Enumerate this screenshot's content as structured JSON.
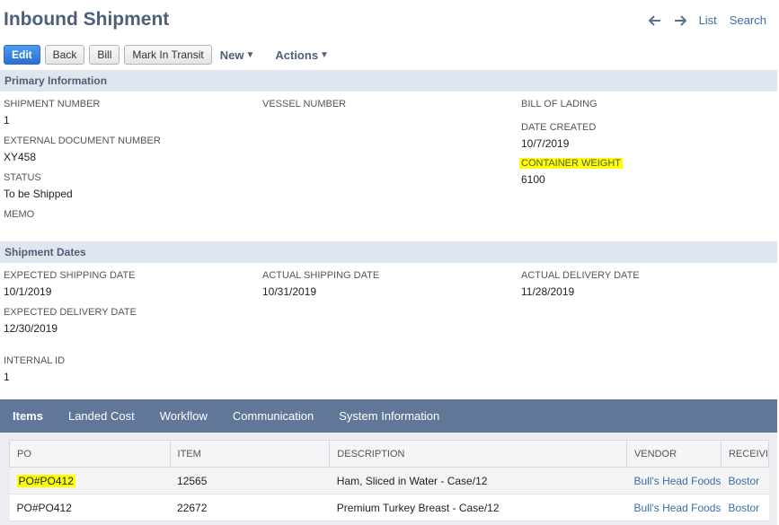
{
  "page": {
    "title": "Inbound Shipment"
  },
  "topnav": {
    "list": "List",
    "search": "Search"
  },
  "toolbar": {
    "edit": "Edit",
    "back": "Back",
    "bill": "Bill",
    "mark_in_transit": "Mark In Transit",
    "new": "New",
    "actions": "Actions"
  },
  "primary": {
    "header": "Primary Information",
    "shipment_number_label": "SHIPMENT NUMBER",
    "shipment_number": "1",
    "external_doc_label": "EXTERNAL DOCUMENT NUMBER",
    "external_doc": "XY458",
    "status_label": "STATUS",
    "status": "To be Shipped",
    "memo_label": "MEMO",
    "vessel_label": "VESSEL NUMBER",
    "bol_label": "BILL OF LADING",
    "date_created_label": "DATE CREATED",
    "date_created": "10/7/2019",
    "container_weight_label": "CONTAINER WEIGHT",
    "container_weight": "6100"
  },
  "dates": {
    "header": "Shipment Dates",
    "exp_ship_label": "EXPECTED SHIPPING DATE",
    "exp_ship": "10/1/2019",
    "act_ship_label": "ACTUAL SHIPPING DATE",
    "act_ship": "10/31/2019",
    "act_deliv_label": "ACTUAL DELIVERY DATE",
    "act_deliv": "11/28/2019",
    "exp_deliv_label": "EXPECTED DELIVERY DATE",
    "exp_deliv": "12/30/2019",
    "internal_id_label": "INTERNAL ID",
    "internal_id": "1"
  },
  "tabs": [
    "Items",
    "Landed Cost",
    "Workflow",
    "Communication",
    "System Information"
  ],
  "items": {
    "columns": [
      "PO",
      "ITEM",
      "DESCRIPTION",
      "VENDOR",
      "RECEIVI"
    ],
    "rows": [
      {
        "po": "PO#PO412",
        "item": "12565",
        "description": "Ham, Sliced in Water - Case/12",
        "vendor": "Bull's Head Foods",
        "receiving": "Bostor"
      },
      {
        "po": "PO#PO412",
        "item": "22672",
        "description": "Premium Turkey Breast - Case/12",
        "vendor": "Bull's Head Foods",
        "receiving": "Bostor"
      }
    ]
  }
}
